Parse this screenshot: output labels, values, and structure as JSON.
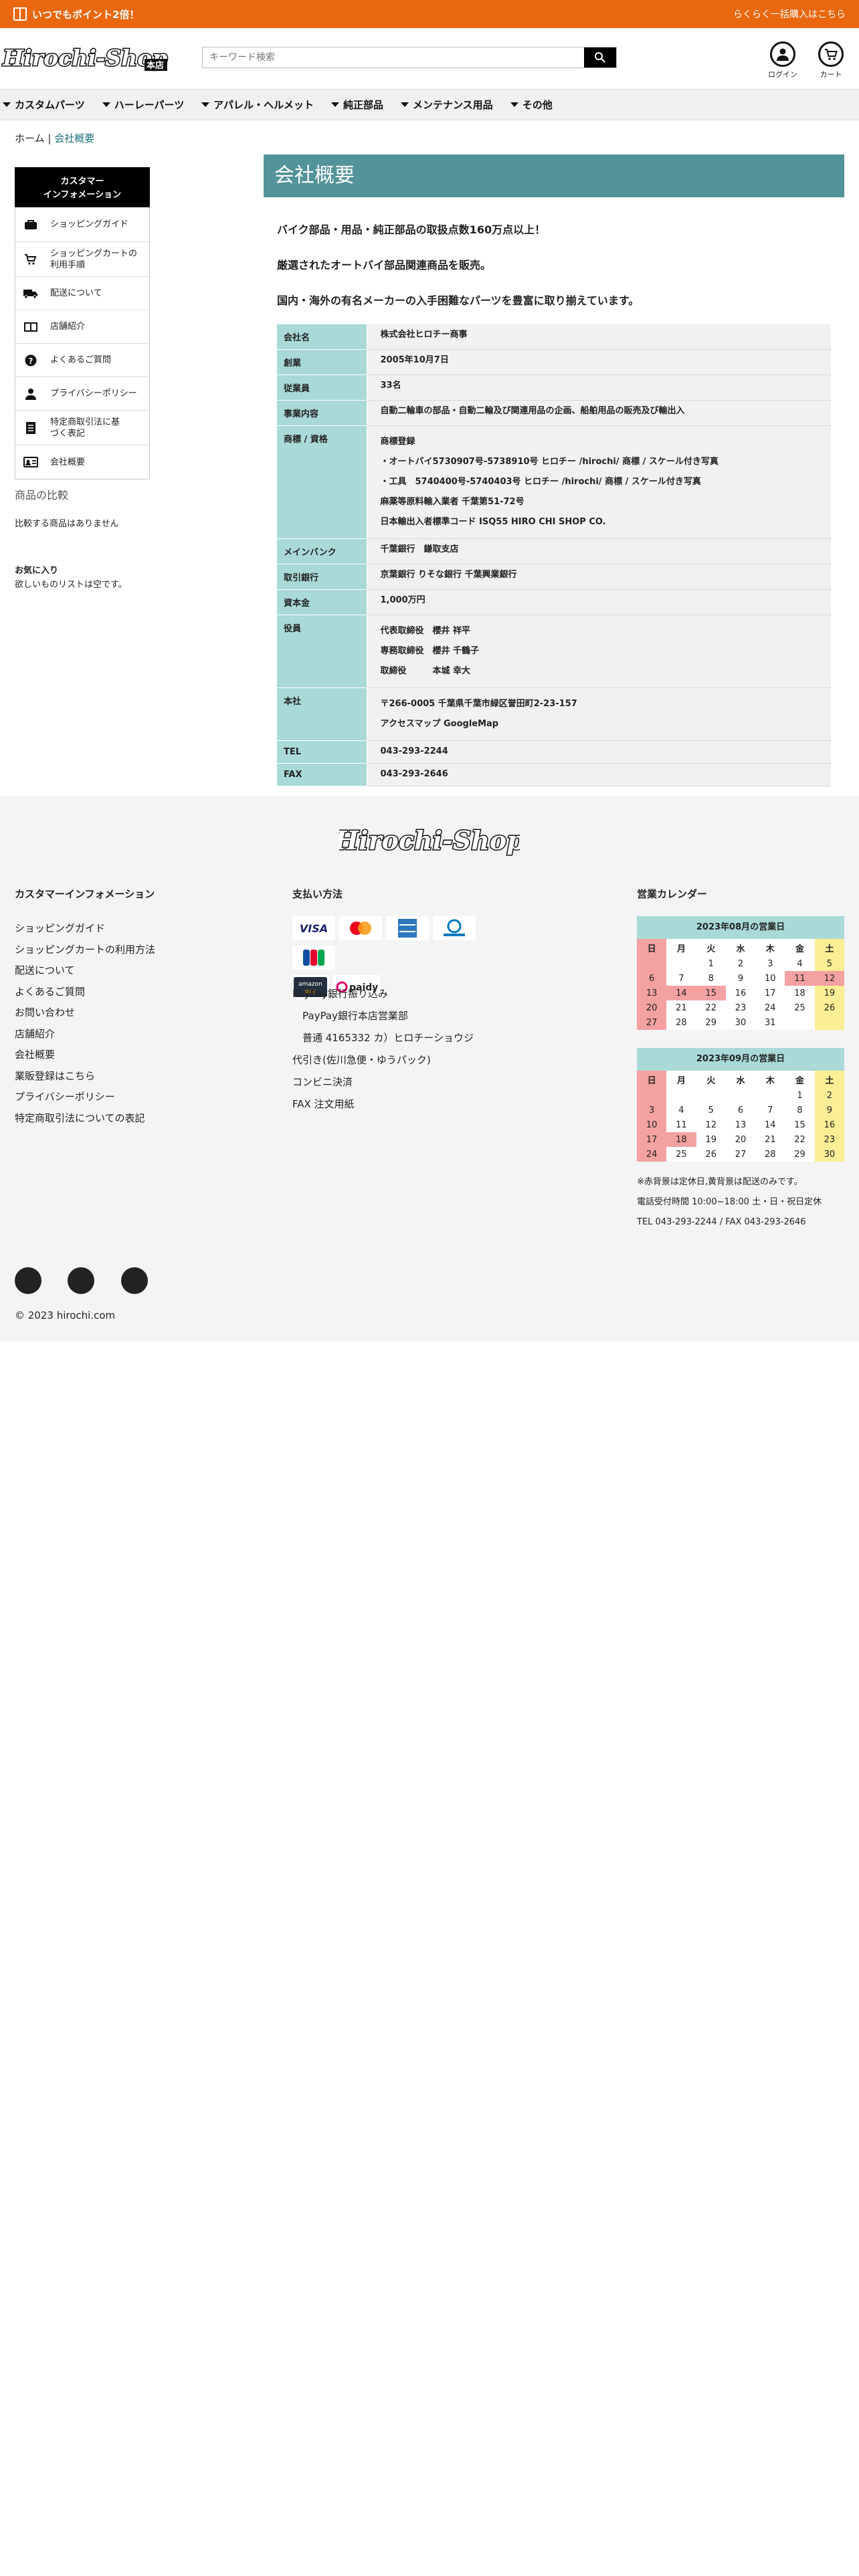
{
  "topbar": {
    "left_text": "いつでもポイント2倍！",
    "right_text": "らくらく一括購入はこちら"
  },
  "header": {
    "logo_text": "Hirochi-Shop",
    "logo_sub": "本店",
    "search_placeholder": "キーワード検索",
    "login_label": "ログイン",
    "cart_label": "カート"
  },
  "nav": [
    "カスタムパーツ",
    "ハーレーパーツ",
    "アパレル・ヘルメット",
    "純正部品",
    "メンテナンス用品",
    "その他"
  ],
  "breadcrumb": {
    "home": "ホーム",
    "sep": "|",
    "current": "会社概要"
  },
  "sidebar": {
    "head_line1": "カスタマー",
    "head_line2": "インフォメーション",
    "items": [
      {
        "label": "ショッピングガイド",
        "icon": "shopping-bag-icon"
      },
      {
        "label": "ショッピングカートの利用手順",
        "icon": "cart-icon"
      },
      {
        "label": "配送について",
        "icon": "truck-icon"
      },
      {
        "label": "店舗紹介",
        "icon": "store-icon"
      },
      {
        "label": "よくあるご質問",
        "icon": "question-icon"
      },
      {
        "label": "プライバシーポリシー",
        "icon": "user-icon"
      },
      {
        "label": "特定商取引法に基づく表記",
        "icon": "document-icon"
      },
      {
        "label": "会社概要",
        "icon": "id-card-icon"
      }
    ],
    "compare_title": "商品の比較",
    "compare_text": "比較する商品はありません",
    "fav_title": "お気に入り",
    "fav_text": "欲しいものリストは空です。"
  },
  "page": {
    "title": "会社概要",
    "intro": [
      "バイク部品・用品・純正部品の取扱点数160万点以上！",
      "厳選されたオートバイ部品関連商品を販売。",
      "国内・海外の有名メーカーの入手困難なパーツを豊富に取り揃えています。"
    ]
  },
  "company_table": [
    {
      "label": "会社名",
      "lines": [
        "株式会社ヒロチー商事"
      ]
    },
    {
      "label": "創業",
      "lines": [
        "2005年10月7日"
      ]
    },
    {
      "label": "従業員",
      "lines": [
        "33名"
      ]
    },
    {
      "label": "事業内容",
      "lines": [
        "自動二輪車の部品・自動二輪及び関連用品の企画、船舶用品の販売及び輸出入"
      ]
    },
    {
      "label": "商標 / 資格",
      "lines": [
        "商標登録",
        "・オートバイ5730907号-5738910号 ヒロチー /hirochi/ 商標 / スケール付き写真",
        "・工具　5740400号-5740403号 ヒロチー /hirochi/ 商標 / スケール付き写真",
        "麻薬等原料輸入業者 千葉第51-72号",
        "日本輸出入者標準コード ISQ55 HIRO CHI SHOP CO."
      ]
    },
    {
      "label": "メインバンク",
      "lines": [
        "千葉銀行　鎌取支店"
      ]
    },
    {
      "label": "取引銀行",
      "lines": [
        "京葉銀行 りそな銀行 千葉興業銀行"
      ]
    },
    {
      "label": "資本金",
      "lines": [
        "1,000万円"
      ]
    },
    {
      "label": "役員",
      "lines": [
        "代表取締役　櫻井 祥平",
        "専務取締役　櫻井 千鶴子",
        "取締役　　　本城 幸大"
      ]
    },
    {
      "label": "本社",
      "lines": [
        "〒266-0005 千葉県千葉市緑区誉田町2-23-157",
        "アクセスマップ GoogleMap"
      ]
    },
    {
      "label": "TEL",
      "lines": [
        "043-293-2244"
      ]
    },
    {
      "label": "FAX",
      "lines": [
        "043-293-2646"
      ]
    }
  ],
  "footer": {
    "logo_text": "Hirochi-Shop",
    "customer_title": "カスタマーインフォメーション",
    "customer_links": [
      "ショッピングガイド",
      "ショッピングカートの利用方法",
      "配送について",
      "よくあるご質問",
      "お問い合わせ",
      "店舗紹介",
      "会社概要",
      "業販登録はこちら",
      "プライバシーポリシー",
      "特定商取引法についての表記"
    ],
    "payment_title": "支払い方法",
    "cards": [
      "VISA",
      "Mastercard",
      "AMEX",
      "Diners Club",
      "JCB",
      "amazon pay",
      "paidy"
    ],
    "payment_lines": [
      "PayPay銀行振り込み",
      "　PayPay銀行本店営業部",
      "　普通 4165332 カ）ヒロチーショウジ",
      "代引き(佐川急便・ゆうパック)",
      "コンビニ決済",
      "FAX 注文用紙"
    ],
    "calendar_title": "営業カレンダー",
    "weekdays": [
      "日",
      "月",
      "火",
      "水",
      "木",
      "金",
      "土"
    ],
    "calendars": [
      {
        "title": "2023年08月の営業日",
        "weeks": [
          [
            "",
            "",
            "1",
            "2",
            "3",
            "4",
            "5"
          ],
          [
            "6",
            "7",
            "8",
            "9",
            "10",
            "11",
            "12"
          ],
          [
            "13",
            "14",
            "15",
            "16",
            "17",
            "18",
            "19"
          ],
          [
            "20",
            "21",
            "22",
            "23",
            "24",
            "25",
            "26"
          ],
          [
            "27",
            "28",
            "29",
            "30",
            "31",
            "",
            ""
          ]
        ],
        "holidays": [
          "11",
          "12",
          "14",
          "15"
        ]
      },
      {
        "title": "2023年09月の営業日",
        "weeks": [
          [
            "",
            "",
            "",
            "",
            "",
            "1",
            "2"
          ],
          [
            "3",
            "4",
            "5",
            "6",
            "7",
            "8",
            "9"
          ],
          [
            "10",
            "11",
            "12",
            "13",
            "14",
            "15",
            "16"
          ],
          [
            "17",
            "18",
            "19",
            "20",
            "21",
            "22",
            "23"
          ],
          [
            "24",
            "25",
            "26",
            "27",
            "28",
            "29",
            "30"
          ]
        ],
        "holidays": [
          "18"
        ]
      }
    ],
    "cal_note1": "※赤背景は定休日,黄背景は配送のみです。",
    "cal_note2": "電話受付時間 10:00~18:00 土・日・祝日定休",
    "cal_note3": "TEL 043-293-2244 / FAX 043-293-2646",
    "social": [
      "facebook-icon",
      "twitter-icon",
      "instagram-icon"
    ],
    "copyright": "© 2023 hirochi.com"
  }
}
